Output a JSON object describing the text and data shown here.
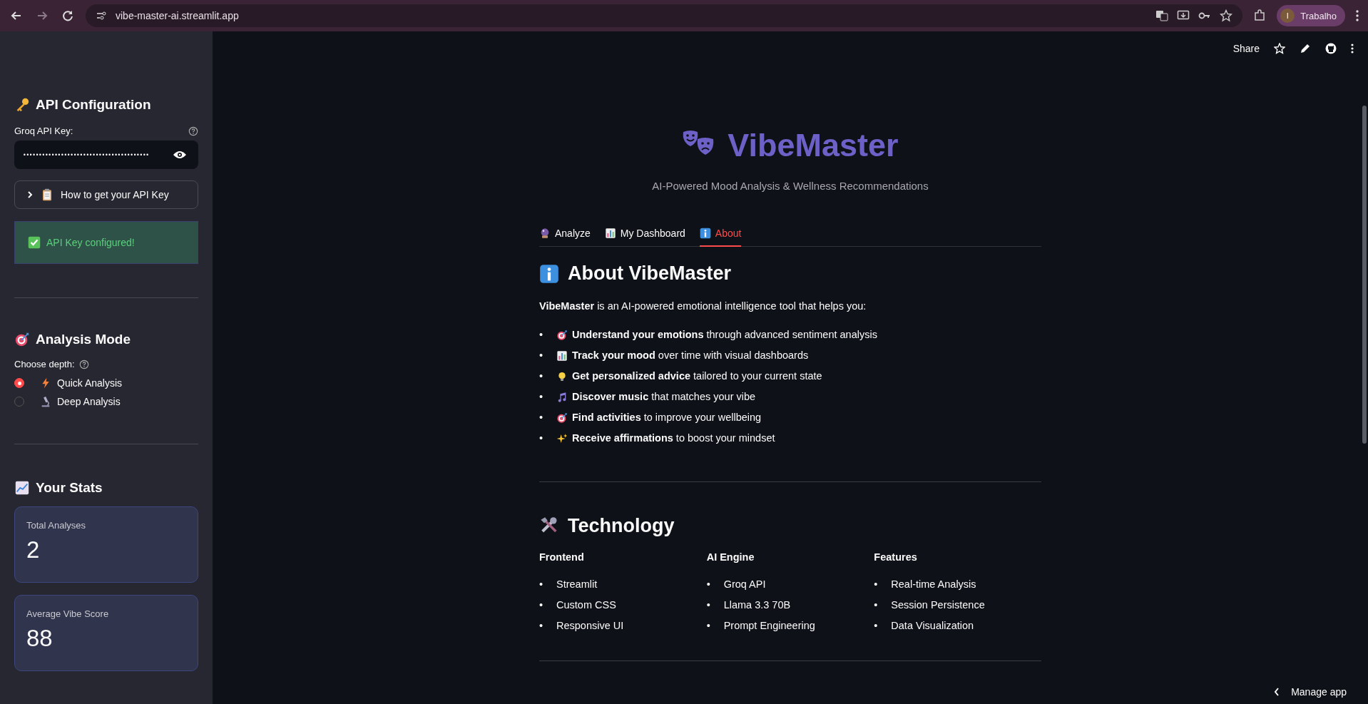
{
  "browser": {
    "url": "vibe-master-ai.streamlit.app",
    "profile_initial": "I",
    "profile_name": "Trabalho"
  },
  "app_toolbar": {
    "share": "Share"
  },
  "sidebar": {
    "api": {
      "heading": "API Configuration",
      "key_label": "Groq API Key:",
      "key_value": "••••••••••••••••••••••••••••••••••••••••",
      "expander": {
        "label": "How to get your API Key",
        "expanded": false
      },
      "success": "API Key configured!"
    },
    "mode": {
      "heading": "Analysis Mode",
      "label": "Choose depth:",
      "options": [
        {
          "label": "Quick Analysis",
          "kind": "bolt",
          "selected": true
        },
        {
          "label": "Deep Analysis",
          "kind": "microscope",
          "selected": false
        }
      ]
    },
    "stats": {
      "heading": "Your Stats",
      "metrics": [
        {
          "label": "Total Analyses",
          "value": "2"
        },
        {
          "label": "Average Vibe Score",
          "value": "88"
        }
      ]
    }
  },
  "main": {
    "title": "VibeMaster",
    "subtitle": "AI-Powered Mood Analysis & Wellness Recommendations",
    "tabs": [
      {
        "label": "Analyze",
        "kind": "ball",
        "selected": false
      },
      {
        "label": "My Dashboard",
        "kind": "chart",
        "selected": false
      },
      {
        "label": "About",
        "kind": "info",
        "selected": true
      }
    ],
    "about": {
      "heading": "About VibeMaster",
      "intro": "**VibeMaster** is an AI-powered emotional intelligence tool that helps you:",
      "features": [
        {
          "bullet": "•",
          "kind": "target",
          "text": "**Understand your emotions** through advanced sentiment analysis"
        },
        {
          "bullet": "•",
          "kind": "chart",
          "text": "**Track your mood** over time with visual dashboards"
        },
        {
          "bullet": "•",
          "kind": "bulb",
          "text": "**Get personalized advice** tailored to your current state"
        },
        {
          "bullet": "•",
          "kind": "music",
          "text": "**Discover music** that matches your vibe"
        },
        {
          "bullet": "•",
          "kind": "target",
          "text": "**Find activities** to improve your wellbeing"
        },
        {
          "bullet": "•",
          "kind": "sparkles",
          "text": "**Receive affirmations** to boost your mindset"
        }
      ]
    },
    "technology": {
      "heading": "Technology",
      "columns": [
        {
          "heading": "Frontend",
          "items": [
            {
              "bullet": "•",
              "text": "Streamlit"
            },
            {
              "bullet": "•",
              "text": "Custom CSS"
            },
            {
              "bullet": "•",
              "text": "Responsive UI"
            }
          ]
        },
        {
          "heading": "AI Engine",
          "items": [
            {
              "bullet": "•",
              "text": "Groq API"
            },
            {
              "bullet": "•",
              "text": "Llama 3.3 70B"
            },
            {
              "bullet": "•",
              "text": "Prompt Engineering"
            }
          ]
        },
        {
          "heading": "Features",
          "items": [
            {
              "bullet": "•",
              "text": "Real-time Analysis"
            },
            {
              "bullet": "•",
              "text": "Session Persistence"
            },
            {
              "bullet": "•",
              "text": "Data Visualization"
            }
          ]
        }
      ]
    }
  },
  "manage_app": "Manage app"
}
